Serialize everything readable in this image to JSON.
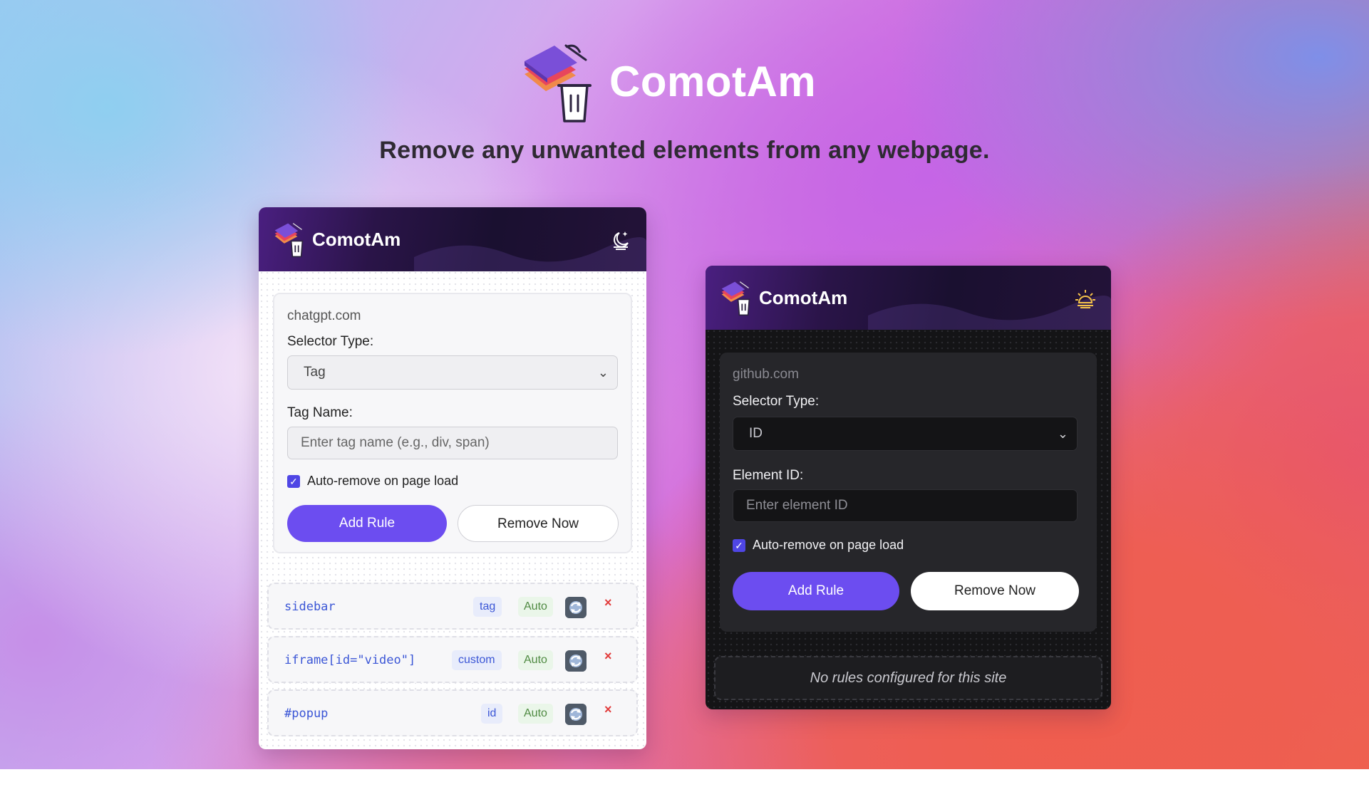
{
  "hero": {
    "title": "ComotAm",
    "tagline": "Remove any unwanted elements from any webpage."
  },
  "light_popup": {
    "app_name": "ComotAm",
    "theme_icon": "moon-stars-icon",
    "site": "chatgpt.com",
    "selector_type_label": "Selector Type:",
    "selector_type_value": "Tag",
    "field_label": "Tag Name:",
    "field_placeholder": "Enter tag name (e.g., div, span)",
    "auto_remove_label": "Auto-remove on page load",
    "auto_remove_checked": true,
    "add_rule_label": "Add Rule",
    "remove_now_label": "Remove Now",
    "rules": [
      {
        "selector": "sidebar",
        "type": "tag",
        "mode": "Auto"
      },
      {
        "selector": "iframe[id=\"video\"]",
        "type": "custom",
        "mode": "Auto"
      },
      {
        "selector": "#popup",
        "type": "id",
        "mode": "Auto"
      }
    ],
    "delete_symbol": "×"
  },
  "dark_popup": {
    "app_name": "ComotAm",
    "theme_icon": "sun-icon",
    "site": "github.com",
    "selector_type_label": "Selector Type:",
    "selector_type_value": "ID",
    "field_label": "Element ID:",
    "field_placeholder": "Enter element ID",
    "auto_remove_label": "Auto-remove on page load",
    "auto_remove_checked": true,
    "add_rule_label": "Add Rule",
    "remove_now_label": "Remove Now",
    "empty_message": "No rules configured for this site"
  },
  "colors": {
    "accent": "#6c4df0",
    "header_dark": "#1a1030",
    "delete_red": "#e23b3b"
  }
}
